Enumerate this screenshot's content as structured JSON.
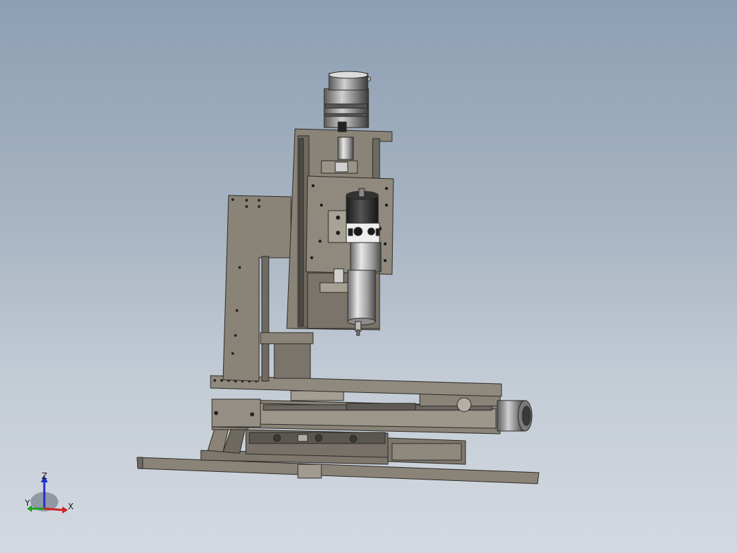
{
  "viewport": {
    "background_top": "#8c9fb3",
    "background_bottom": "#d3d9e0"
  },
  "model": {
    "part_color": "#8a8478",
    "edge_color": "#2c2a26",
    "metal_color": "#b8b8b8",
    "dark_color": "#2a2a2a"
  },
  "triad": {
    "z_label": "Z",
    "x_label": "X",
    "y_label": "Y",
    "z_color": "#2030c8",
    "x_color": "#d02020",
    "y_color": "#20a020"
  }
}
